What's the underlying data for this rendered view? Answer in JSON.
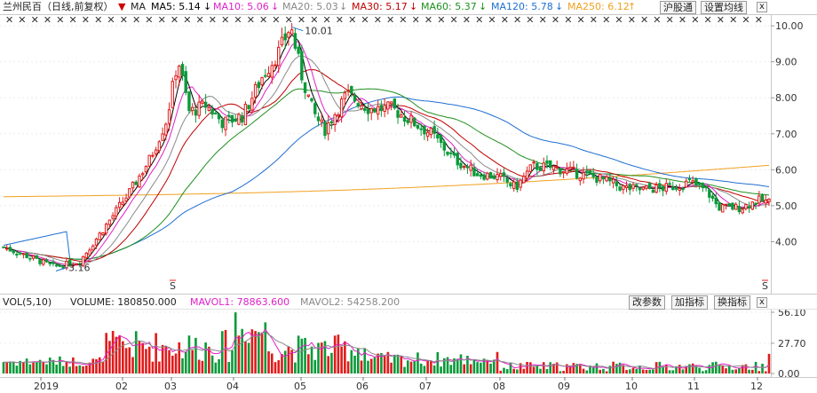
{
  "header": {
    "title": "兰州民百（日线,前复权）",
    "ma_label": "MA",
    "ma5": "MA5: 5.14",
    "ma10": "MA10: 5.06",
    "ma20": "MA20: 5.03",
    "ma30": "MA30: 5.17",
    "ma60": "MA60: 5.37",
    "ma120": "MA120: 5.78",
    "ma250": "MA250: 6.12",
    "hugutong_button": "沪股通",
    "ma_settings_button": "设置均线",
    "close_glyph": "x"
  },
  "colors": {
    "up": "#e01b1b",
    "down": "#0a9a3a",
    "ma5": "#000000",
    "ma10": "#e020c8",
    "ma20": "#8a8a8a",
    "ma30": "#c00000",
    "ma60": "#1e8f1e",
    "ma120": "#1f6fd0",
    "ma250": "#f0a020"
  },
  "price_axis": {
    "ticks": [
      "10.00",
      "9.00",
      "8.00",
      "7.00",
      "6.00",
      "5.00",
      "4.00"
    ],
    "max_marker": "10.01",
    "min_marker": "3.16",
    "signal_glyph": "S"
  },
  "volume": {
    "header_left": "VOL(5,10)",
    "volume_value": "VOLUME: 180850.000",
    "mavol1": "MAVOL1: 78863.600",
    "mavol2": "MAVOL2: 54258.200",
    "change_params_button": "改参数",
    "add_indicator_button": "加指标",
    "switch_indicator_button": "换指标",
    "close_glyph": "x",
    "ticks": [
      "56.10",
      "27.70",
      "0.00"
    ]
  },
  "date_axis": [
    "2019",
    "02",
    "03",
    "04",
    "05",
    "06",
    "07",
    "08",
    "09",
    "10",
    "11",
    "12"
  ],
  "chart_data": {
    "type": "candlestick",
    "title": "兰州民百（日线,前复权）",
    "ylim": [
      3.0,
      10.2
    ],
    "price_max": 10.01,
    "price_min": 3.16,
    "months": [
      "2019-01",
      "02",
      "03",
      "04",
      "05",
      "06",
      "07",
      "08",
      "09",
      "10",
      "11",
      "12"
    ],
    "close_anchors": [
      {
        "month": "2019-01 start",
        "close": 3.8
      },
      {
        "month": "2019-01 end",
        "close": 3.35
      },
      {
        "month": "02 early",
        "close": 4.4
      },
      {
        "month": "02 end",
        "close": 6.3
      },
      {
        "month": "03 peak",
        "close": 9.1
      },
      {
        "month": "03 end",
        "close": 7.4
      },
      {
        "month": "04 end",
        "close": 10.01
      },
      {
        "month": "05 early",
        "close": 7.2
      },
      {
        "month": "05 end",
        "close": 7.8
      },
      {
        "month": "06",
        "close": 7.6
      },
      {
        "month": "07",
        "close": 6.0
      },
      {
        "month": "08",
        "close": 5.5
      },
      {
        "month": "08 end",
        "close": 6.1
      },
      {
        "month": "09",
        "close": 5.85
      },
      {
        "month": "10",
        "close": 5.4
      },
      {
        "month": "11",
        "close": 5.6
      },
      {
        "month": "11 end",
        "close": 4.95
      },
      {
        "month": "12",
        "close": 5.14
      }
    ],
    "ma_last": {
      "MA5": 5.14,
      "MA10": 5.06,
      "MA20": 5.03,
      "MA30": 5.17,
      "MA60": 5.37,
      "MA120": 5.78,
      "MA250": 6.12
    },
    "volume_ylim": [
      0,
      56.1
    ],
    "volume_last": 180850.0,
    "mavol1_last": 78863.6,
    "mavol2_last": 54258.2
  }
}
